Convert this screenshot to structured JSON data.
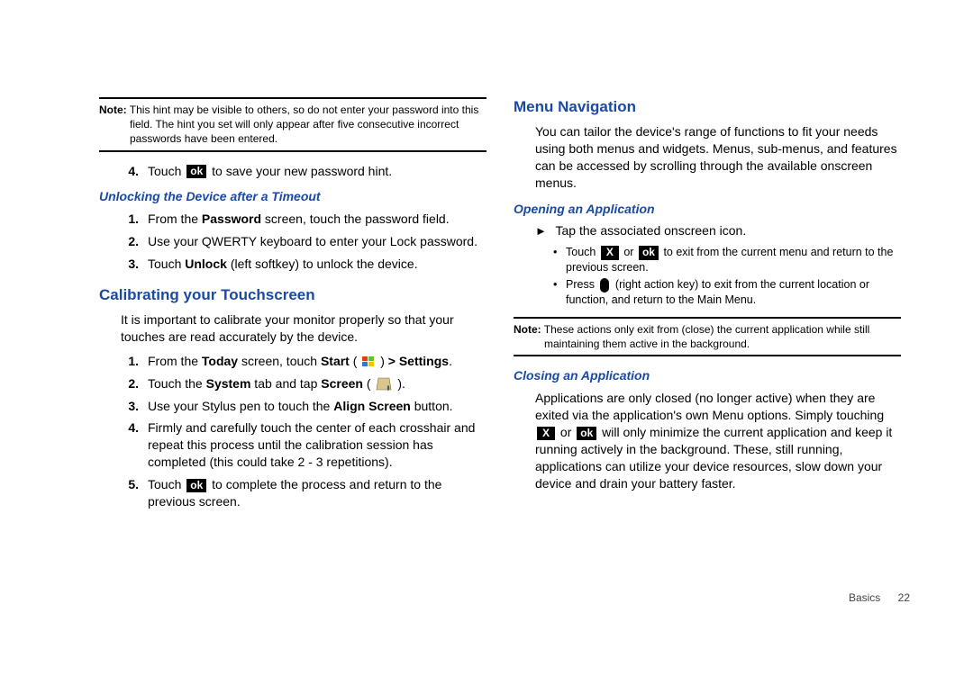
{
  "left": {
    "note": {
      "label": "Note:",
      "text": "This hint may be visible to others, so do not enter your password into this field. The hint you set will only appear after five consecutive incorrect passwords have been entered."
    },
    "step4": {
      "num": "4.",
      "pre": "Touch ",
      "ok": "ok",
      "post": " to save your new password hint."
    },
    "sub_unlock": "Unlocking the Device after a Timeout",
    "unlock_steps": {
      "s1": {
        "num": "1.",
        "pre": "From the ",
        "b1": "Password",
        "post": " screen, touch the password field."
      },
      "s2": {
        "num": "2.",
        "text": "Use your QWERTY keyboard to enter your Lock password."
      },
      "s3": {
        "num": "3.",
        "pre": "Touch ",
        "b1": "Unlock",
        "post": " (left softkey) to unlock the device."
      }
    },
    "h_calibrate": "Calibrating your Touchscreen",
    "calibrate_para": "It is important to calibrate your monitor properly so that your touches are read accurately by the device.",
    "cal_steps": {
      "s1": {
        "num": "1.",
        "pre": "From the ",
        "b1": "Today",
        "mid": " screen, touch ",
        "b2": "Start",
        "paren_open": " ( ",
        "paren_close": " ) ",
        "gt": "> ",
        "b3": "Settings",
        "end": "."
      },
      "s2": {
        "num": "2.",
        "pre": "Touch the ",
        "b1": "System",
        "mid": " tab and tap ",
        "b2": "Screen",
        "paren_open": " ( ",
        "paren_close": " )."
      },
      "s3": {
        "num": "3.",
        "pre": "Use your Stylus pen to touch the ",
        "b1": "Align Screen",
        "post": " button."
      },
      "s4": {
        "num": "4.",
        "text": "Firmly and carefully touch the center of each crosshair and repeat this process until the calibration session has completed (this could take 2 - 3 repetitions)."
      },
      "s5": {
        "num": "5.",
        "pre": "Touch ",
        "ok": "ok",
        "post": " to complete the process and return to the previous screen."
      }
    }
  },
  "right": {
    "h_menu": "Menu Navigation",
    "menu_para": "You can tailor the device's range of functions to fit your needs using both menus and widgets. Menus, sub-menus, and features can be accessed by scrolling through the available onscreen menus.",
    "sub_open": "Opening an Application",
    "tap": "Tap the associated onscreen icon.",
    "bullets": {
      "b1": {
        "pre": "Touch ",
        "x": "X",
        "or": " or ",
        "ok": "ok",
        "post": " to exit from the current menu and return to the previous screen."
      },
      "b2": {
        "pre": "Press ",
        "post": " (right action key) to exit from the current location or function, and return to the Main Menu."
      }
    },
    "note": {
      "label": "Note:",
      "text": "These actions only exit from (close) the current application while still maintaining them active in the background."
    },
    "sub_close": "Closing an Application",
    "close_para": {
      "p1": "Applications are only closed (no longer active) when they are exited via the application's own Menu options. Simply touching ",
      "x": "X",
      "or": " or ",
      "ok": "ok",
      "p2": " will only minimize the current application and keep it running actively in the background. These, still running, applications can utilize your device resources, slow down your device and drain your battery faster."
    }
  },
  "footer": {
    "section": "Basics",
    "page": "22"
  },
  "icons": {
    "arrow": "►"
  }
}
